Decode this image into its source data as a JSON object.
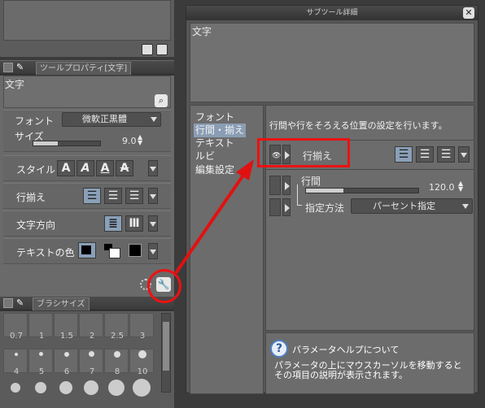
{
  "left": {
    "tool_property": {
      "tab_label": "ツールプロパティ[文字]",
      "title": "文字",
      "rows": {
        "font": {
          "label": "フォント",
          "value": "微軟正黒體"
        },
        "size": {
          "label": "サイズ",
          "value": "9.0"
        },
        "style": {
          "label": "スタイル"
        },
        "align": {
          "label": "行揃え"
        },
        "direction": {
          "label": "文字方向"
        },
        "color": {
          "label": "テキストの色"
        }
      }
    },
    "brush_size": {
      "tab_label": "ブラシサイズ",
      "row1": [
        "0.7",
        "1",
        "1.5",
        "2",
        "2.5",
        "3"
      ],
      "row2": [
        "4",
        "5",
        "6",
        "7",
        "8",
        "10"
      ]
    }
  },
  "dialog": {
    "title": "サブツール詳細",
    "close": "✕",
    "preview_text": "文字",
    "categories": [
      "フォント",
      "行間・揃え",
      "テキスト",
      "ルビ",
      "編集設定"
    ],
    "selected_category": "行間・揃え",
    "description": "行間や行をそろえる位置の設定を行います。",
    "rows": {
      "align": {
        "label": "行揃え"
      },
      "spacing": {
        "label": "行間",
        "value": "120.0"
      },
      "method": {
        "label": "指定方法",
        "value": "パーセント指定"
      }
    },
    "help": {
      "title": "パラメータヘルプについて",
      "body": "パラメータの上にマウスカーソルを移動すると\nその項目の説明が表示されます。"
    }
  },
  "colors": {
    "highlight": "#e11111",
    "accent_selected": "#8a9db4"
  }
}
